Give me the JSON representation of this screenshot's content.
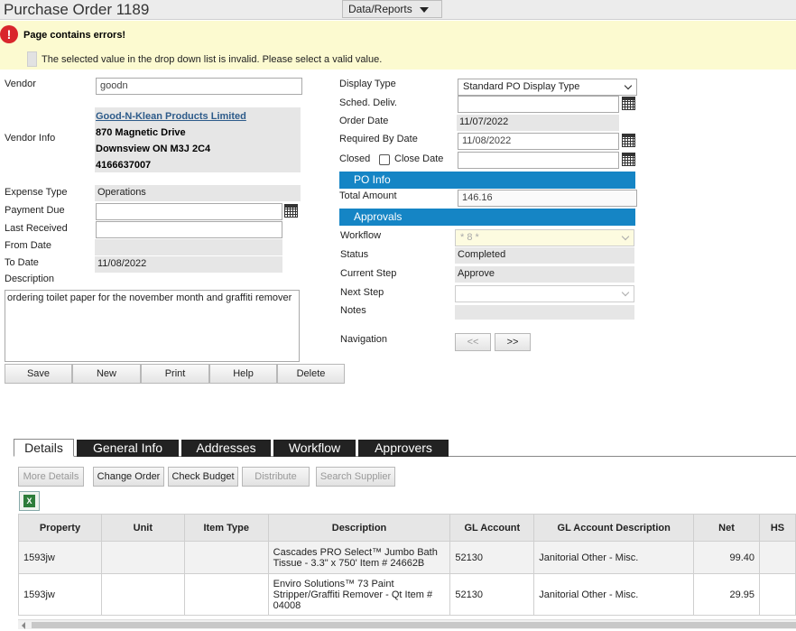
{
  "header": {
    "title": "Purchase Order 1189",
    "data_reports_label": "Data/Reports"
  },
  "errors": {
    "title": "Page contains errors!",
    "message": "The selected value in the drop down list is invalid. Please select a valid value."
  },
  "left_form": {
    "vendor_label": "Vendor",
    "vendor_value": "goodn",
    "vendor_info_label": "Vendor Info",
    "vendor_info": {
      "name": "Good-N-Klean Products Limited",
      "address1": "870 Magnetic Drive",
      "address2": "Downsview ON M3J 2C4",
      "phone": "4166637007"
    },
    "expense_type_label": "Expense Type",
    "expense_type_value": "Operations",
    "payment_due_label": "Payment Due",
    "payment_due_value": "",
    "last_received_label": "Last Received",
    "last_received_value": "",
    "from_date_label": "From Date",
    "from_date_value": "",
    "to_date_label": "To Date",
    "to_date_value": "11/08/2022",
    "description_label": "Description",
    "description_value": "ordering toilet paper for the november month and graffiti remover"
  },
  "actions": {
    "save": "Save",
    "new": "New",
    "print": "Print",
    "help": "Help",
    "delete": "Delete"
  },
  "right_form": {
    "display_type_label": "Display Type",
    "display_type_value": "Standard PO Display Type",
    "sched_deliv_label": "Sched. Deliv.",
    "sched_deliv_value": "",
    "order_date_label": "Order Date",
    "order_date_value": "11/07/2022",
    "required_by_label": "Required By Date",
    "required_by_value": "11/08/2022",
    "closed_label": "Closed",
    "close_date_label": "Close Date",
    "close_date_value": "",
    "po_info_header": "PO Info",
    "total_amount_label": "Total Amount",
    "total_amount_value": "146.16",
    "approvals_header": "Approvals",
    "workflow_label": "Workflow",
    "workflow_value": "* 8 *",
    "status_label": "Status",
    "status_value": "Completed",
    "current_step_label": "Current Step",
    "current_step_value": "Approve",
    "next_step_label": "Next Step",
    "next_step_value": "",
    "notes_label": "Notes",
    "notes_value": "",
    "navigation_label": "Navigation",
    "nav_prev": "<<",
    "nav_next": ">>"
  },
  "tabs": [
    {
      "label": "Details",
      "active": true
    },
    {
      "label": "General Info"
    },
    {
      "label": "Addresses"
    },
    {
      "label": "Workflow"
    },
    {
      "label": "Approvers"
    }
  ],
  "detail_toolbar": {
    "more_details": "More Details",
    "change_order": "Change Order",
    "check_budget": "Check Budget",
    "distribute": "Distribute",
    "search_supplier": "Search Supplier"
  },
  "grid": {
    "columns": [
      "Property",
      "Unit",
      "Item Type",
      "Description",
      "GL Account",
      "GL Account Description",
      "Net",
      "HS"
    ],
    "rows": [
      {
        "property": "1593jw",
        "unit": "",
        "item_type": "",
        "description": "Cascades PRO Select™ Jumbo Bath Tissue - 3.3\" x 750' Item # 24662B",
        "gl_account": "52130",
        "gl_desc": "Janitorial Other - Misc.",
        "net": "99.40"
      },
      {
        "property": "1593jw",
        "unit": "",
        "item_type": "",
        "description": "Enviro Solutions™ 73 Paint Stripper/Graffiti Remover - Qt Item # 04008",
        "gl_account": "52130",
        "gl_desc": "Janitorial Other - Misc.",
        "net": "29.95"
      }
    ]
  },
  "colors": {
    "section_header": "#1585c5",
    "error_bg": "#fcfad0",
    "error_icon": "#d9262c",
    "link": "#2d5b8a"
  }
}
